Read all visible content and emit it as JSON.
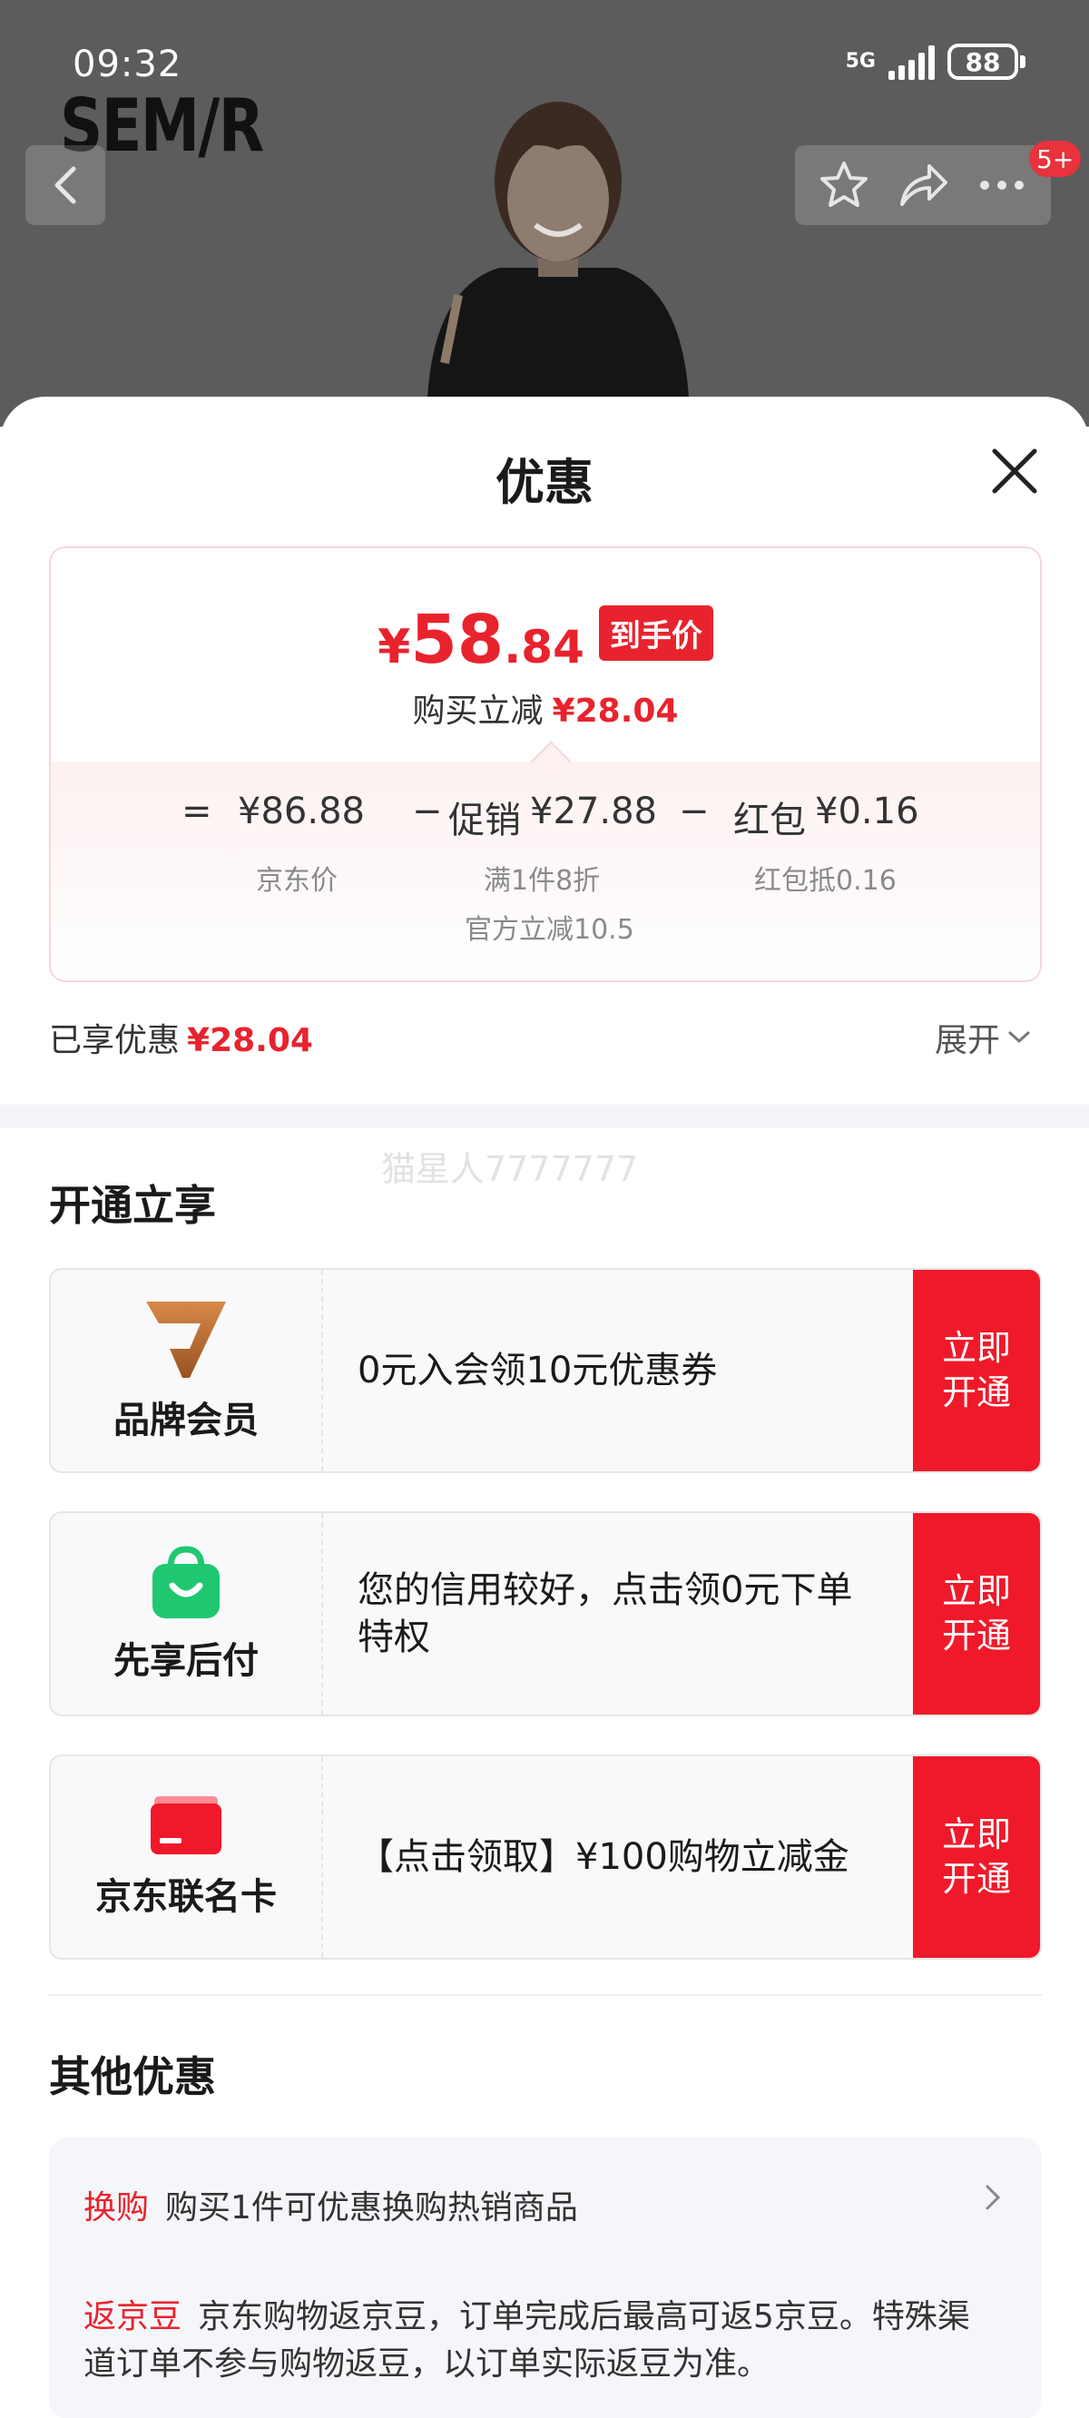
{
  "status_bar": {
    "time": "09:32",
    "network": "5G",
    "battery": "88"
  },
  "header": {
    "brand": "SEM/R",
    "badge": "5+"
  },
  "sheet": {
    "title": "优惠",
    "price": {
      "yen": "¥",
      "integer": "58",
      "decimal": ".84",
      "tag": "到手价",
      "reduce_label": "购买立减",
      "reduce_value": "¥28.04"
    },
    "breakdown": {
      "equals": "=",
      "jd_price": "¥86.88",
      "jd_price_label": "京东价",
      "minus1": "−",
      "promo_label": "促销",
      "promo_value": "¥27.88",
      "promo_sub1": "满1件8折",
      "promo_sub2": "官方立减10.5",
      "minus2": "−",
      "redpack_label": "红包",
      "redpack_value": "¥0.16",
      "redpack_sub": "红包抵0.16"
    },
    "enjoyed_label": "已享优惠",
    "enjoyed_value": "¥28.04",
    "expand": "展开",
    "watermark": "猫星人7777777"
  },
  "open_section": {
    "title": "开通立享",
    "items": [
      {
        "name": "品牌会员",
        "desc": "0元入会领10元优惠券",
        "button": "立即开通",
        "icon": "brand-member-icon"
      },
      {
        "name": "先享后付",
        "desc": "您的信用较好，点击领0元下单特权",
        "button": "立即开通",
        "icon": "shopping-bag-icon"
      },
      {
        "name": "京东联名卡",
        "desc": "【点击领取】¥100购物立减金",
        "button": "立即开通",
        "icon": "credit-card-icon"
      }
    ]
  },
  "other_section": {
    "title": "其他优惠",
    "exchange_tag": "换购",
    "exchange_text": "购买1件可优惠换购热销商品",
    "bean_tag": "返京豆",
    "bean_text": "京东购物返京豆，订单完成后最高可返5京豆。特殊渠道订单不参与购物返豆，以订单实际返豆为准。"
  },
  "colors": {
    "accent_red": "#e8232d",
    "button_red": "#f0192a",
    "member_gold": "#b8662a",
    "bag_green": "#1fc870"
  }
}
